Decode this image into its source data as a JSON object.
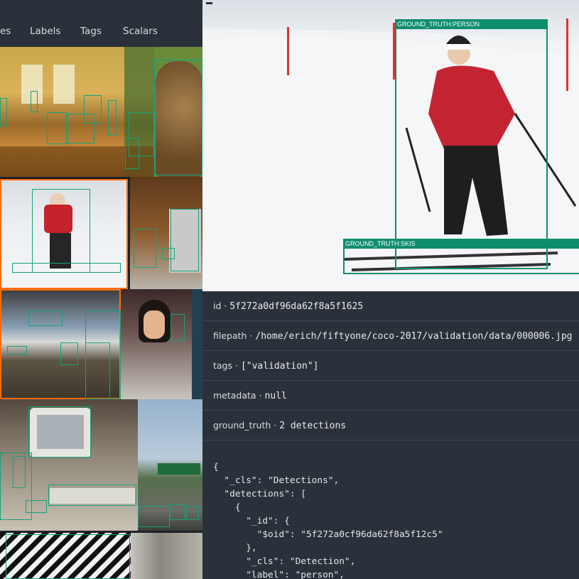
{
  "tabs": [
    {
      "label": "es"
    },
    {
      "label": "Labels"
    },
    {
      "label": "Tags"
    },
    {
      "label": "Scalars"
    }
  ],
  "colors": {
    "accent": "#ff6d04",
    "box": "#0e8e6d",
    "panel": "#2b313a"
  },
  "image_view": {
    "labels": [
      "GROUND_TRUTH:PERSON",
      "GROUND_TRUTH:SKIS"
    ]
  },
  "fields": {
    "id_key": "id",
    "id_value": "5f272a0df96da62f8a5f1625",
    "filepath_key": "filepath",
    "filepath_value": "/home/erich/fiftyone/coco-2017/validation/data/000006.jpg",
    "tags_key": "tags",
    "tags_value": "[\"validation\"]",
    "metadata_key": "metadata",
    "metadata_value": "null",
    "ground_truth_key": "ground_truth",
    "ground_truth_value": "2 detections"
  },
  "json_lines": [
    "{",
    "  \"_cls\": \"Detections\",",
    "  \"detections\": [",
    "    {",
    "      \"_id\": {",
    "        \"$oid\": \"5f272a0cf96da62f8a5f12c5\"",
    "      },",
    "      \"_cls\": \"Detection\",",
    "      \"label\": \"person\","
  ]
}
